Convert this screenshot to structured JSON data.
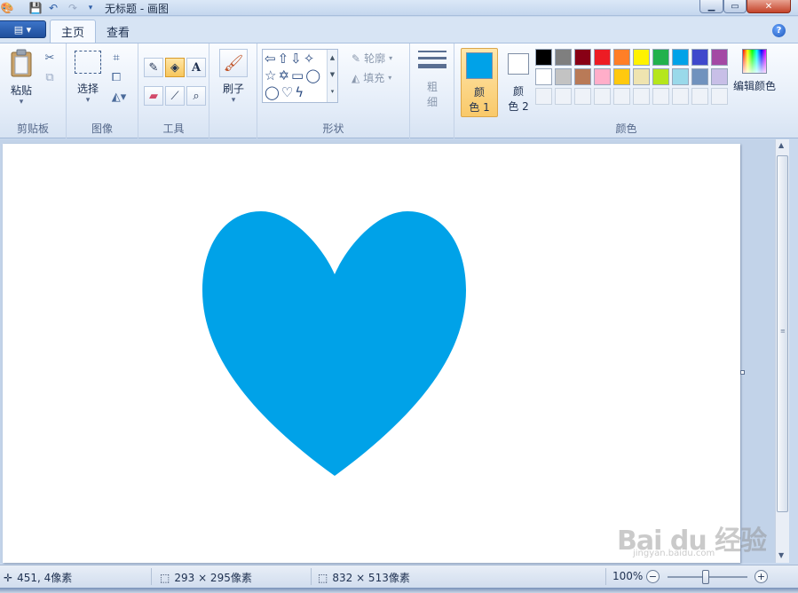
{
  "window": {
    "title": "无标题 - 画图"
  },
  "tabs": [
    {
      "label": "主页"
    },
    {
      "label": "查看"
    }
  ],
  "ribbon": {
    "clipboard": {
      "paste_label": "粘贴",
      "group_label": "剪贴板"
    },
    "image": {
      "select_label": "选择",
      "group_label": "图像"
    },
    "tools": {
      "group_label": "工具"
    },
    "brushes": {
      "label": "刷子"
    },
    "shapes": {
      "outline_label": "轮廓",
      "fill_label": "填充",
      "group_label": "形状"
    },
    "size": {
      "line1": "粗",
      "line2": "细"
    },
    "colors": {
      "color1_line1": "颜",
      "color1_line2": "色 1",
      "color2_line1": "颜",
      "color2_line2": "色 2",
      "color1_value": "#00a2e8",
      "color2_value": "#ffffff",
      "edit_label": "编辑颜色",
      "group_label": "颜色",
      "palette_row1": [
        "#000000",
        "#7f7f7f",
        "#880015",
        "#ed1c24",
        "#ff7f27",
        "#fff200",
        "#22b14c",
        "#00a2e8",
        "#3f48cc",
        "#a349a4"
      ],
      "palette_row2": [
        "#ffffff",
        "#c3c3c3",
        "#b97a57",
        "#ffaec9",
        "#ffc90e",
        "#efe4b0",
        "#b5e61d",
        "#99d9ea",
        "#7092be",
        "#c8bfe7"
      ]
    }
  },
  "canvas": {
    "shape": "heart",
    "fill_color": "#00a2e8"
  },
  "status": {
    "cursor_pos": "451, 4像素",
    "selection_size": "293 × 295像素",
    "image_size": "832 × 513像素",
    "zoom": "100%"
  },
  "watermark": {
    "text": "Bai du 经验",
    "url": "jingyan.baidu.com"
  }
}
